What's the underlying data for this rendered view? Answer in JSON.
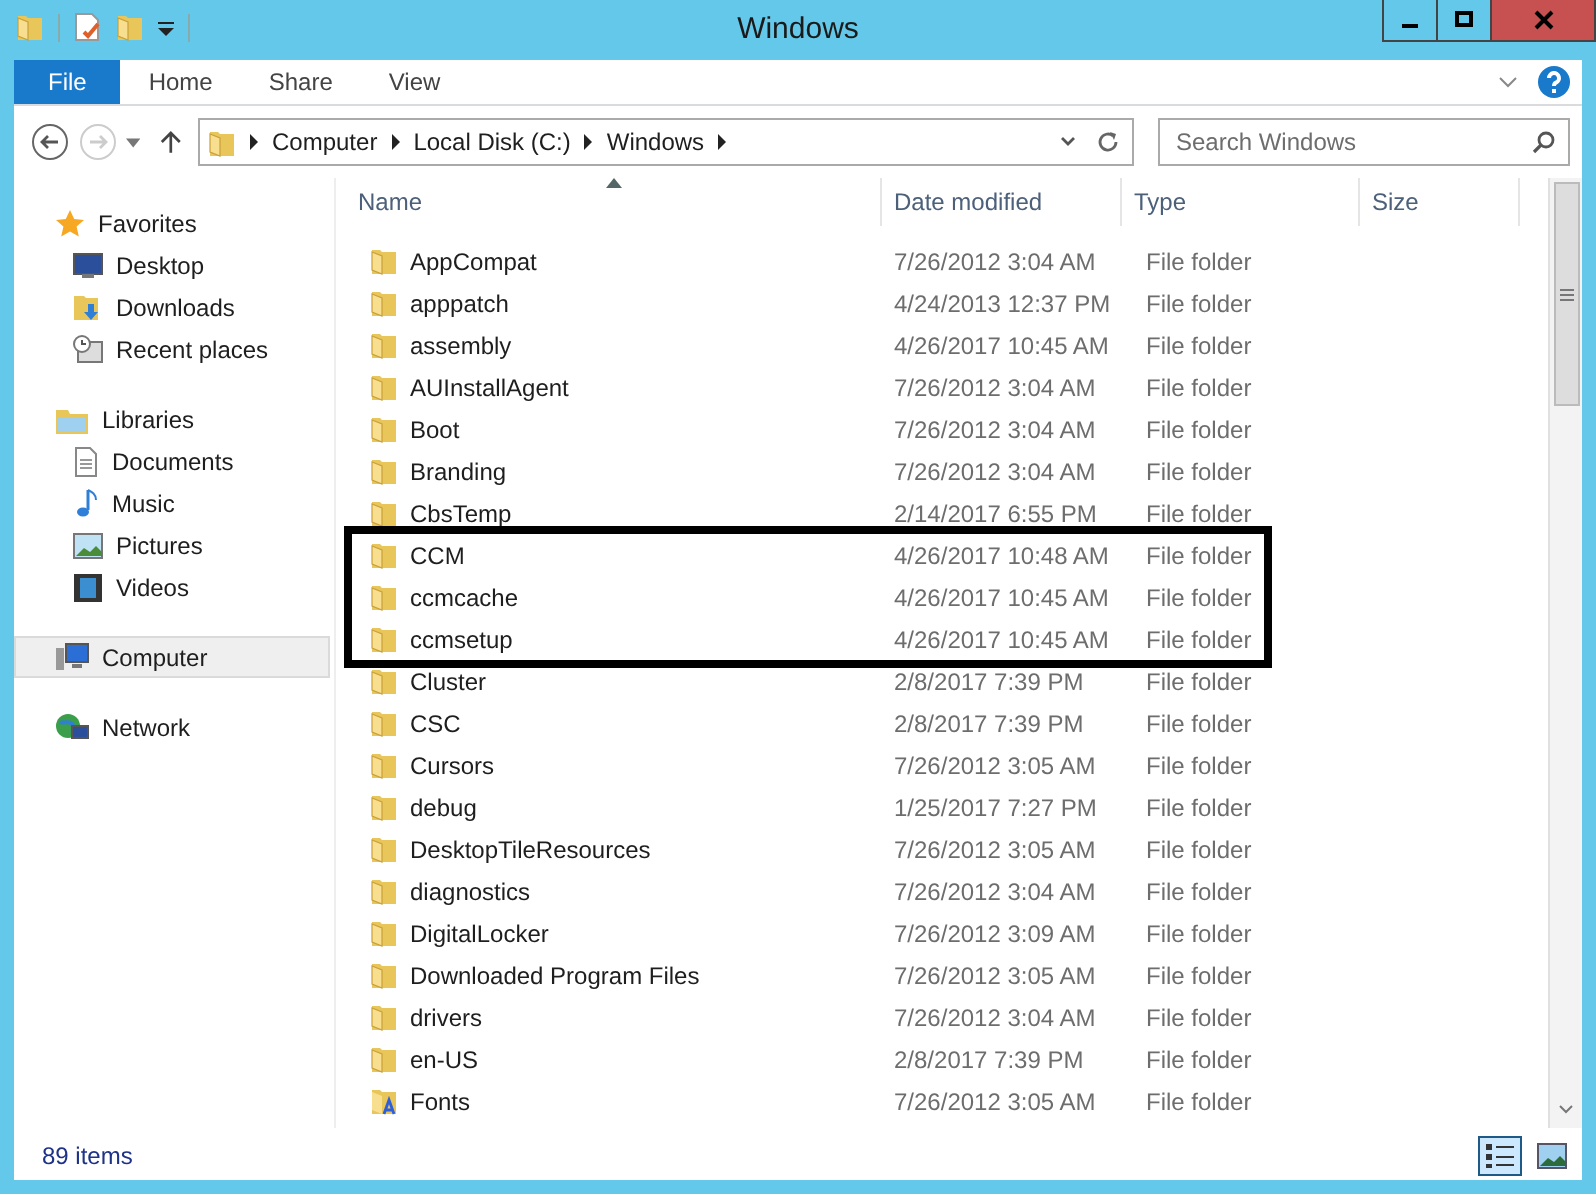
{
  "window": {
    "title": "Windows"
  },
  "ribbon": {
    "tabs": [
      {
        "label": "File",
        "kind": "file",
        "selected": false
      },
      {
        "label": "Home",
        "kind": "tab",
        "selected": false
      },
      {
        "label": "Share",
        "kind": "tab",
        "selected": false
      },
      {
        "label": "View",
        "kind": "tab",
        "selected": false
      }
    ]
  },
  "nav": {
    "back_disabled": false,
    "forward_disabled": true
  },
  "address": {
    "crumbs": [
      "Computer",
      "Local Disk (C:)",
      "Windows"
    ]
  },
  "search": {
    "placeholder": "Search Windows"
  },
  "sidebar": {
    "groups": [
      {
        "label": "Favorites",
        "kind": "star",
        "selected": false,
        "children": [
          {
            "label": "Desktop",
            "kind": "desktop",
            "selected": false
          },
          {
            "label": "Downloads",
            "kind": "downloads",
            "selected": false
          },
          {
            "label": "Recent places",
            "kind": "recent",
            "selected": false
          }
        ]
      },
      {
        "label": "Libraries",
        "kind": "library",
        "selected": false,
        "children": [
          {
            "label": "Documents",
            "kind": "documents",
            "selected": false
          },
          {
            "label": "Music",
            "kind": "music",
            "selected": false
          },
          {
            "label": "Pictures",
            "kind": "pictures",
            "selected": false
          },
          {
            "label": "Videos",
            "kind": "videos",
            "selected": false
          }
        ]
      },
      {
        "label": "Computer",
        "kind": "computer",
        "selected": true
      },
      {
        "label": "Network",
        "kind": "network",
        "selected": false
      }
    ]
  },
  "table": {
    "columns": [
      {
        "label": "Name",
        "sorted": true
      },
      {
        "label": "Date modified",
        "sorted": false
      },
      {
        "label": "Type",
        "sorted": false
      },
      {
        "label": "Size",
        "sorted": false
      }
    ],
    "rows": [
      {
        "name": "AppCompat",
        "date": "7/26/2012 3:04 AM",
        "type": "File folder",
        "kind": "folder",
        "boxed": false
      },
      {
        "name": "apppatch",
        "date": "4/24/2013 12:37 PM",
        "type": "File folder",
        "kind": "folder",
        "boxed": false
      },
      {
        "name": "assembly",
        "date": "4/26/2017 10:45 AM",
        "type": "File folder",
        "kind": "folder",
        "boxed": false
      },
      {
        "name": "AUInstallAgent",
        "date": "7/26/2012 3:04 AM",
        "type": "File folder",
        "kind": "folder",
        "boxed": false
      },
      {
        "name": "Boot",
        "date": "7/26/2012 3:04 AM",
        "type": "File folder",
        "kind": "folder",
        "boxed": false
      },
      {
        "name": "Branding",
        "date": "7/26/2012 3:04 AM",
        "type": "File folder",
        "kind": "folder",
        "boxed": false
      },
      {
        "name": "CbsTemp",
        "date": "2/14/2017 6:55 PM",
        "type": "File folder",
        "kind": "folder",
        "boxed": false
      },
      {
        "name": "CCM",
        "date": "4/26/2017 10:48 AM",
        "type": "File folder",
        "kind": "folder",
        "boxed": true
      },
      {
        "name": "ccmcache",
        "date": "4/26/2017 10:45 AM",
        "type": "File folder",
        "kind": "folder",
        "boxed": true
      },
      {
        "name": "ccmsetup",
        "date": "4/26/2017 10:45 AM",
        "type": "File folder",
        "kind": "folder",
        "boxed": true
      },
      {
        "name": "Cluster",
        "date": "2/8/2017 7:39 PM",
        "type": "File folder",
        "kind": "folder",
        "boxed": false
      },
      {
        "name": "CSC",
        "date": "2/8/2017 7:39 PM",
        "type": "File folder",
        "kind": "folder",
        "boxed": false
      },
      {
        "name": "Cursors",
        "date": "7/26/2012 3:05 AM",
        "type": "File folder",
        "kind": "folder",
        "boxed": false
      },
      {
        "name": "debug",
        "date": "1/25/2017 7:27 PM",
        "type": "File folder",
        "kind": "folder",
        "boxed": false
      },
      {
        "name": "DesktopTileResources",
        "date": "7/26/2012 3:05 AM",
        "type": "File folder",
        "kind": "folder",
        "boxed": false
      },
      {
        "name": "diagnostics",
        "date": "7/26/2012 3:04 AM",
        "type": "File folder",
        "kind": "folder",
        "boxed": false
      },
      {
        "name": "DigitalLocker",
        "date": "7/26/2012 3:09 AM",
        "type": "File folder",
        "kind": "folder",
        "boxed": false
      },
      {
        "name": "Downloaded Program Files",
        "date": "7/26/2012 3:05 AM",
        "type": "File folder",
        "kind": "folder",
        "boxed": false
      },
      {
        "name": "drivers",
        "date": "7/26/2012 3:04 AM",
        "type": "File folder",
        "kind": "folder",
        "boxed": false
      },
      {
        "name": "en-US",
        "date": "2/8/2017 7:39 PM",
        "type": "File folder",
        "kind": "folder",
        "boxed": false
      },
      {
        "name": "Fonts",
        "date": "7/26/2012 3:05 AM",
        "type": "File folder",
        "kind": "fonts",
        "boxed": false
      }
    ]
  },
  "status_bar": {
    "count": "89 items",
    "views": [
      {
        "kind": "details",
        "selected": true
      },
      {
        "kind": "thumbnails",
        "selected": false
      }
    ]
  }
}
